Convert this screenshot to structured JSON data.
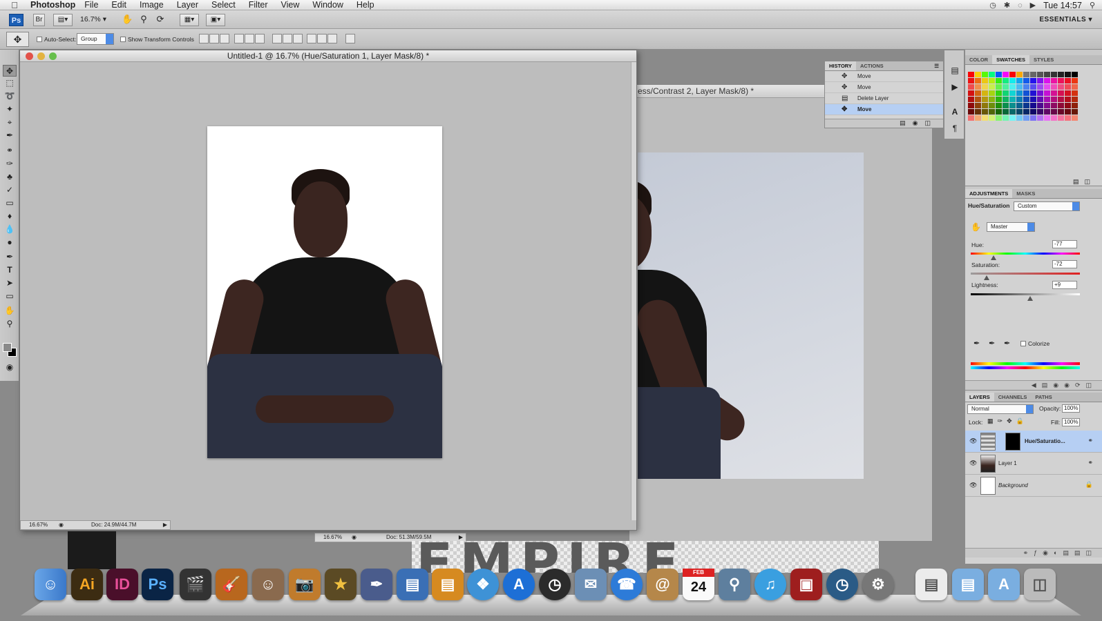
{
  "menubar": {
    "app_name": "Photoshop",
    "items": [
      "File",
      "Edit",
      "Image",
      "Layer",
      "Select",
      "Filter",
      "View",
      "Window",
      "Help"
    ],
    "clock": "Tue 14:57"
  },
  "appbar": {
    "ps_badge": "Ps",
    "br_badge": "Br",
    "zoom": "16.7%",
    "workspace": "ESSENTIALS"
  },
  "options": {
    "auto_select_label": "Auto-Select:",
    "auto_select_value": "Group",
    "transform_label": "Show Transform Controls"
  },
  "doc1": {
    "title": "Untitled-1 @ 16.7% (Hue/Saturation 1, Layer Mask/8) *",
    "zoom": "16.67%",
    "doc_size": "Doc: 24.9M/44.7M"
  },
  "doc2": {
    "title": "ess/Contrast 2, Layer Mask/8) *",
    "zoom": "16.67%",
    "doc_size": "Doc: 51.3M/59.5M"
  },
  "history": {
    "tabs": [
      "HISTORY",
      "ACTIONS"
    ],
    "rows": [
      "Move",
      "Move",
      "Delete Layer",
      "Move"
    ]
  },
  "color_panel": {
    "tabs": [
      "COLOR",
      "SWATCHES",
      "STYLES"
    ]
  },
  "adjustments": {
    "tabs": [
      "ADJUSTMENTS",
      "MASKS"
    ],
    "type": "Hue/Saturation",
    "preset": "Custom",
    "channel": "Master",
    "hue_label": "Hue:",
    "hue_value": "-77",
    "saturation_label": "Saturation:",
    "saturation_value": "-72",
    "lightness_label": "Lightness:",
    "lightness_value": "+9",
    "colorize_label": "Colorize"
  },
  "layers": {
    "tabs": [
      "LAYERS",
      "CHANNELS",
      "PATHS"
    ],
    "blend_mode": "Normal",
    "opacity_label": "Opacity:",
    "opacity": "100%",
    "lock_label": "Lock:",
    "fill_label": "Fill:",
    "fill": "100%",
    "rows": [
      "Hue/Saturatio...",
      "Layer 1",
      "Background"
    ]
  },
  "wallpaper": {
    "text": "EMPIRE"
  },
  "dock": {
    "ai": "Ai",
    "id": "ID",
    "ps": "Ps",
    "calendar_month": "FEB",
    "calendar_day": "24"
  }
}
